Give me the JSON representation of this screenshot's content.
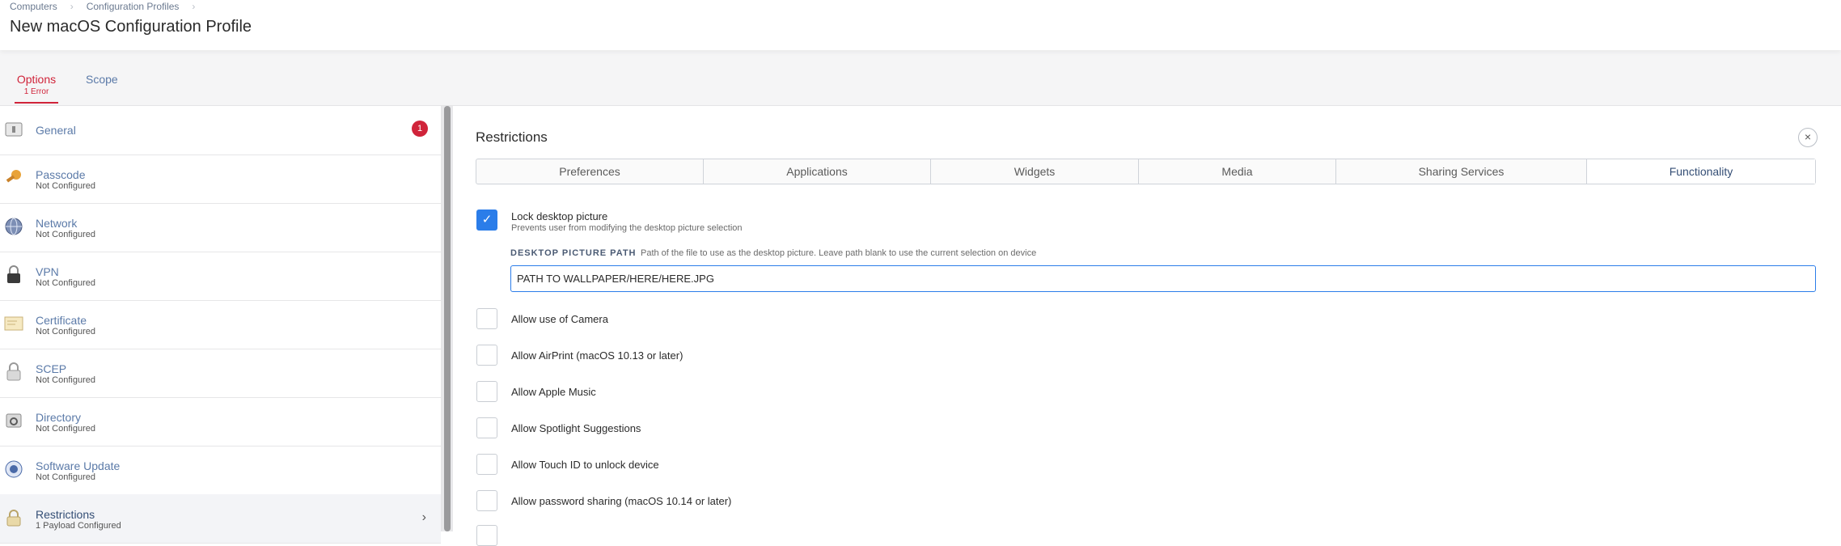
{
  "breadcrumb": [
    "Computers",
    "Configuration Profiles"
  ],
  "page_title": "New macOS Configuration Profile",
  "tabs": {
    "options": {
      "label": "Options",
      "sub": "1 Error"
    },
    "scope": {
      "label": "Scope"
    }
  },
  "sidebar": {
    "items": [
      {
        "label": "General",
        "sub": "",
        "badge": "1",
        "icon": "general-icon"
      },
      {
        "label": "Passcode",
        "sub": "Not Configured",
        "icon": "key-icon"
      },
      {
        "label": "Network",
        "sub": "Not Configured",
        "icon": "globe-icon"
      },
      {
        "label": "VPN",
        "sub": "Not Configured",
        "icon": "lock-icon"
      },
      {
        "label": "Certificate",
        "sub": "Not Configured",
        "icon": "certificate-icon"
      },
      {
        "label": "SCEP",
        "sub": "Not Configured",
        "icon": "padlock-icon"
      },
      {
        "label": "Directory",
        "sub": "Not Configured",
        "icon": "directory-icon"
      },
      {
        "label": "Software Update",
        "sub": "Not Configured",
        "icon": "software-update-icon"
      },
      {
        "label": "Restrictions",
        "sub": "1 Payload Configured",
        "icon": "restrictions-icon"
      }
    ]
  },
  "main": {
    "title": "Restrictions",
    "segments": [
      "Preferences",
      "Applications",
      "Widgets",
      "Media",
      "Sharing Services",
      "Functionality"
    ],
    "active_segment": "Functionality",
    "lock_desktop": {
      "label": "Lock desktop picture",
      "sub": "Prevents user from modifying the desktop picture selection",
      "checked": true
    },
    "desktop_path": {
      "label": "DESKTOP PICTURE PATH",
      "help": "Path of the file to use as the desktop picture. Leave path blank to use the current selection on device",
      "value": "PATH TO WALLPAPER/HERE/HERE.JPG"
    },
    "options": [
      "Allow use of Camera",
      "Allow AirPrint (macOS 10.13 or later)",
      "Allow Apple Music",
      "Allow Spotlight Suggestions",
      "Allow Touch ID to unlock device",
      "Allow password sharing (macOS 10.14 or later)"
    ]
  },
  "colors": {
    "accent_red": "#d0243a",
    "accent_blue": "#2b7de9",
    "link_blue": "#5b7aa8"
  }
}
